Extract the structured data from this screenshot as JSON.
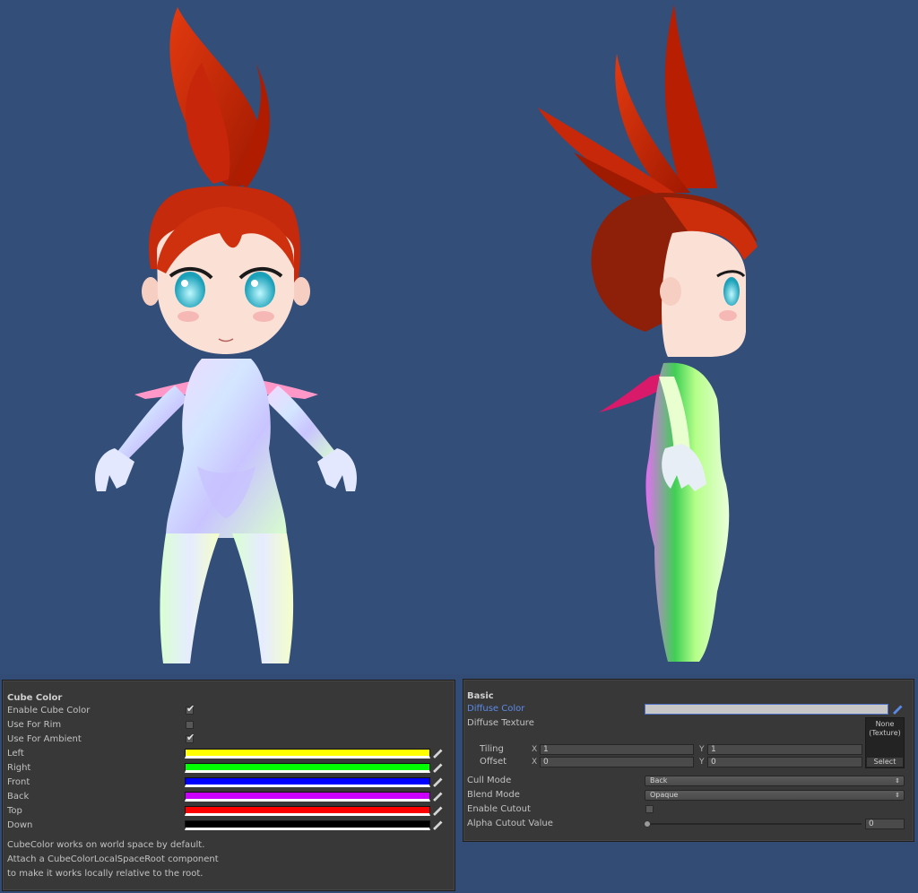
{
  "viewport": {
    "background": "#334e79",
    "figures": [
      "front-view",
      "side-view"
    ]
  },
  "cube_color_panel": {
    "header": "Cube Color",
    "enable_cube_color": {
      "label": "Enable Cube Color",
      "checked": true
    },
    "use_for_rim": {
      "label": "Use For Rim",
      "checked": false
    },
    "use_for_ambient": {
      "label": "Use For Ambient",
      "checked": true
    },
    "colors": [
      {
        "label": "Left",
        "color": "#ffff00"
      },
      {
        "label": "Right",
        "color": "#00ff00"
      },
      {
        "label": "Front",
        "color": "#0000ff"
      },
      {
        "label": "Back",
        "color": "#cc00ff"
      },
      {
        "label": "Top",
        "color": "#ff0000"
      },
      {
        "label": "Down",
        "color": "#000000"
      }
    ],
    "hint": [
      "CubeColor works on world space by default.",
      "Attach a CubeColorLocalSpaceRoot component",
      "to make it works locally relative to the root."
    ],
    "checkmark": "✔"
  },
  "basic_panel": {
    "header": "Basic",
    "diffuse_color": {
      "label": "Diffuse Color",
      "color": "#c7c7c7"
    },
    "diffuse_texture": {
      "label": "Diffuse Texture",
      "preview_none": "None",
      "preview_type": "(Texture)",
      "select": "Select"
    },
    "tiling": {
      "label": "Tiling",
      "x_axis": "X",
      "x": "1",
      "y_axis": "Y",
      "y": "1"
    },
    "offset": {
      "label": "Offset",
      "x_axis": "X",
      "x": "0",
      "y_axis": "Y",
      "y": "0"
    },
    "cull_mode": {
      "label": "Cull Mode",
      "value": "Back"
    },
    "blend_mode": {
      "label": "Blend Mode",
      "value": "Opaque"
    },
    "enable_cutout": {
      "label": "Enable Cutout",
      "checked": false
    },
    "alpha_cutout": {
      "label": "Alpha Cutout Value",
      "value": "0",
      "fraction": 0
    },
    "dropdown_arrow": "⇕"
  }
}
